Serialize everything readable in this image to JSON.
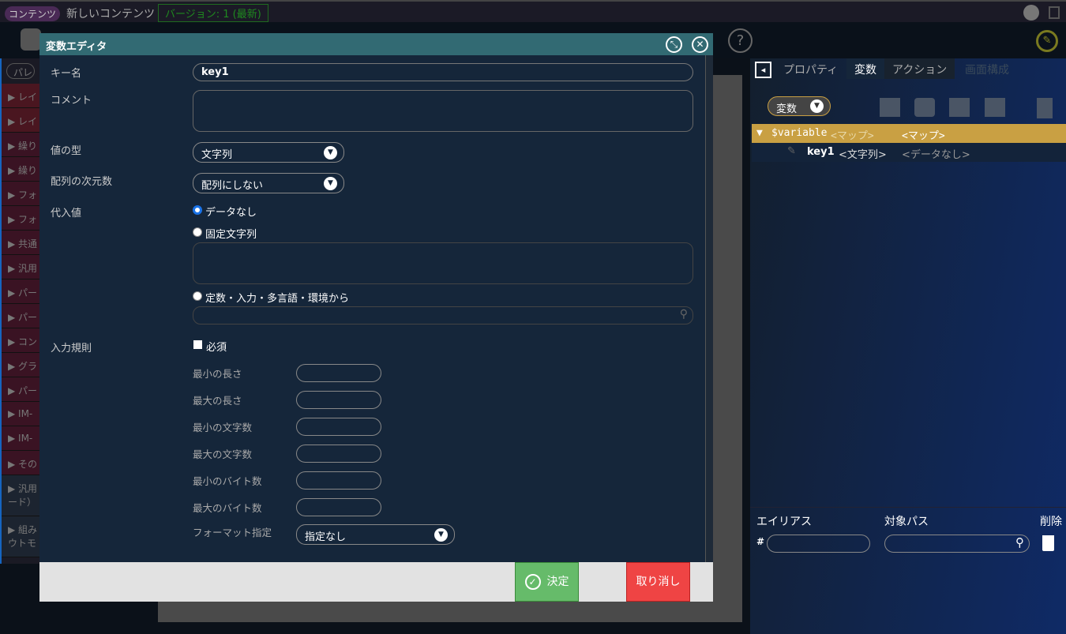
{
  "header": {
    "badge": "コンテンツ",
    "title": "新しいコンテンツ",
    "version": "バージョン: 1 (最新)"
  },
  "palette": {
    "search": "パレッ",
    "items": [
      "レイ",
      "レイ",
      "繰り",
      "繰り",
      "フォ",
      "フォ",
      "共通",
      "汎用",
      "パー",
      "パー",
      "コン",
      "グラ",
      "パー",
      "IM-",
      "IM-",
      "その",
      "汎用\nード）",
      "組み\nウトモ"
    ]
  },
  "dialog": {
    "title": "変数エディタ",
    "key_label": "キー名",
    "key_value": "key1",
    "comment_label": "コメント",
    "type_label": "値の型",
    "type_value": "文字列",
    "dim_label": "配列の次元数",
    "dim_value": "配列にしない",
    "assign_label": "代入値",
    "radio_none": "データなし",
    "radio_fixed": "固定文字列",
    "radio_const": "定数・入力・多言語・環境から",
    "rule_label": "入力規則",
    "required": "必須",
    "min_len": "最小の長さ",
    "max_len": "最大の長さ",
    "min_chars": "最小の文字数",
    "max_chars": "最大の文字数",
    "min_bytes": "最小のバイト数",
    "max_bytes": "最大のバイト数",
    "format_label": "フォーマット指定",
    "format_value": "指定なし",
    "ok": "決定",
    "cancel": "取り消し"
  },
  "right": {
    "tabs": [
      "プロパティ",
      "変数",
      "アクション",
      "画面構成"
    ],
    "var_select": "変数",
    "tree": [
      {
        "name": "$variable",
        "type": "<マップ>",
        "value": "<マップ>"
      },
      {
        "name": "key1",
        "type": "<文字列>",
        "value": "<データなし>"
      }
    ],
    "alias": "エイリアス",
    "path": "対象パス",
    "delete": "削除",
    "hash": "#"
  },
  "colors": {
    "accent": "#c9a043",
    "ok": "#66bb6a",
    "cancel": "#ef4444",
    "title": "#326a73"
  }
}
